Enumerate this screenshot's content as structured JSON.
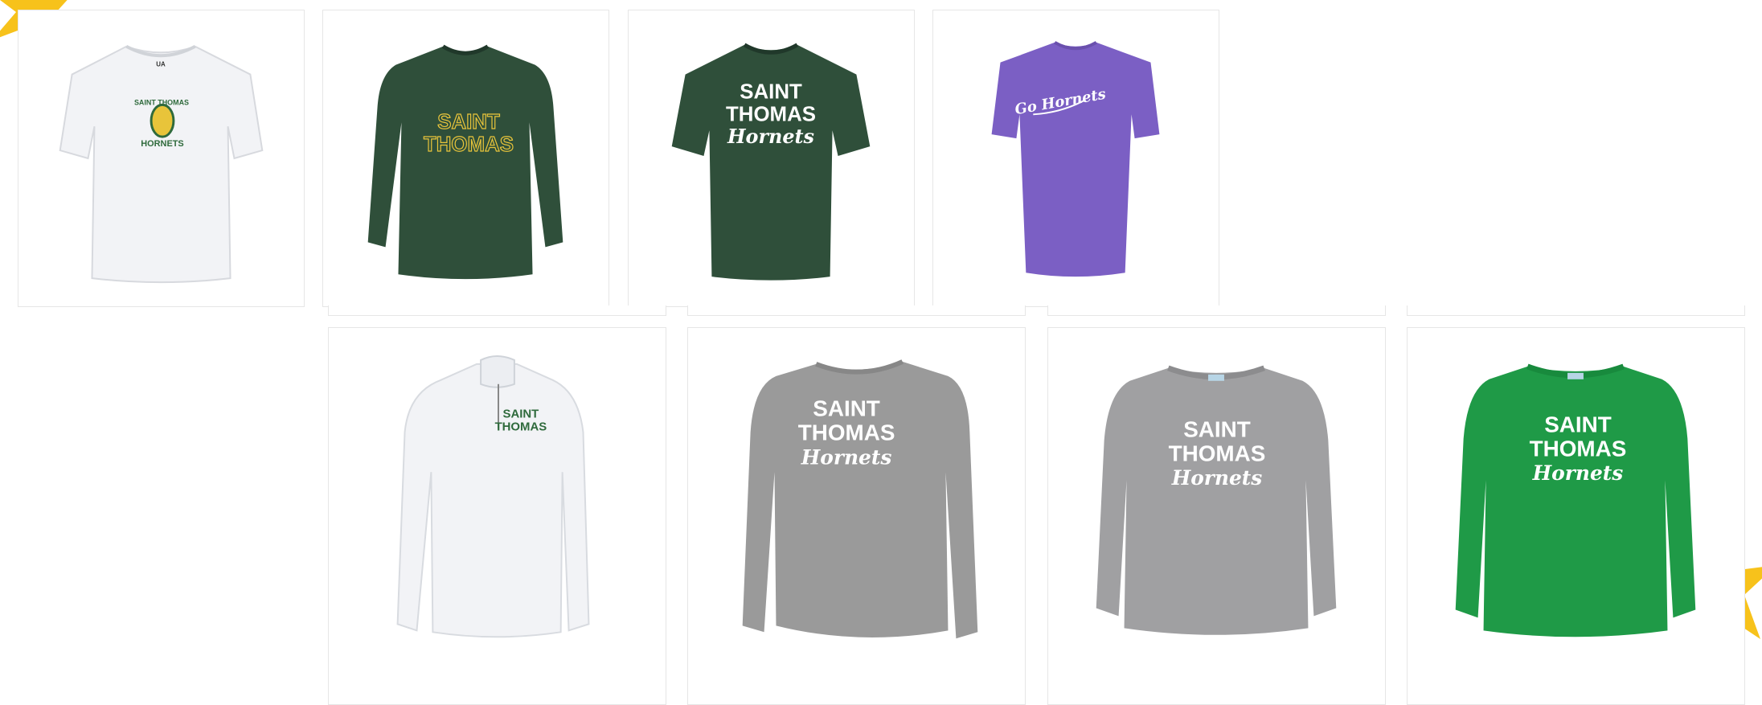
{
  "colors": {
    "forest_green": "#2f4f3a",
    "kelly_green": "#1f9a47",
    "heather_gray": "#9a9a9a",
    "purple": "#7b5fc4",
    "gold": "#e8c43a",
    "white_shirt": "#f2f3f6",
    "star_yellow": "#f7c21b"
  },
  "products": [
    {
      "id": "p1",
      "garment": "short-sleeve-tee",
      "color": "white",
      "print": [
        "SAINT THOMAS",
        "HORNETS"
      ]
    },
    {
      "id": "p2",
      "garment": "long-sleeve-tee",
      "color": "forest-green",
      "print": [
        "SAINT",
        "THOMAS"
      ]
    },
    {
      "id": "p3",
      "garment": "short-sleeve-tee",
      "color": "forest-green",
      "print": [
        "SAINT",
        "THOMAS",
        "Hornets"
      ]
    },
    {
      "id": "p4",
      "garment": "short-sleeve-tee",
      "color": "purple",
      "print": [
        "Go Hornets"
      ]
    },
    {
      "id": "p5",
      "garment": "quarter-zip",
      "color": "white",
      "print": [
        "SAINT",
        "THOMAS"
      ]
    },
    {
      "id": "p6",
      "garment": "crewneck-sweatshirt",
      "color": "heather-gray",
      "print": [
        "SAINT",
        "THOMAS",
        "Hornets"
      ]
    },
    {
      "id": "p7",
      "garment": "crewneck-sweatshirt",
      "color": "heather-gray",
      "print": [
        "SAINT",
        "THOMAS",
        "Hornets"
      ]
    },
    {
      "id": "p8",
      "garment": "crewneck-sweatshirt",
      "color": "kelly-green",
      "print": [
        "SAINT",
        "THOMAS",
        "Hornets"
      ]
    }
  ]
}
